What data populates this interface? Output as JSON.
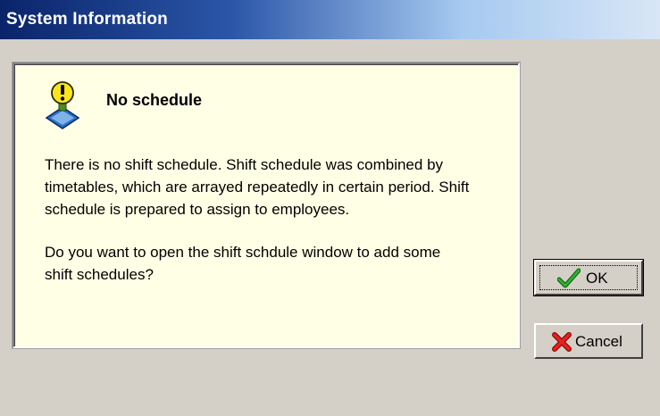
{
  "window": {
    "title": "System Information"
  },
  "message": {
    "icon": "warning-exclamation-icon",
    "heading": "No schedule",
    "paragraphs": [
      "There is no shift schedule. Shift schedule was combined by\ntimetables, which are arrayed repeatedly in certain period. Shift\nschedule is prepared to assign to employees.",
      "Do you want to open the shift schdule window to add some\nshift schedules?"
    ]
  },
  "buttons": {
    "ok": {
      "label": "OK",
      "icon": "checkmark-icon",
      "color": "#1e8c1e"
    },
    "cancel": {
      "label": "Cancel",
      "icon": "red-x-icon",
      "color": "#d01010"
    }
  },
  "colors": {
    "panel_background": "#ffffe6",
    "dialog_background": "#d4d0c8",
    "titlebar_start": "#0a246a",
    "titlebar_end": "#d8e6f6"
  }
}
